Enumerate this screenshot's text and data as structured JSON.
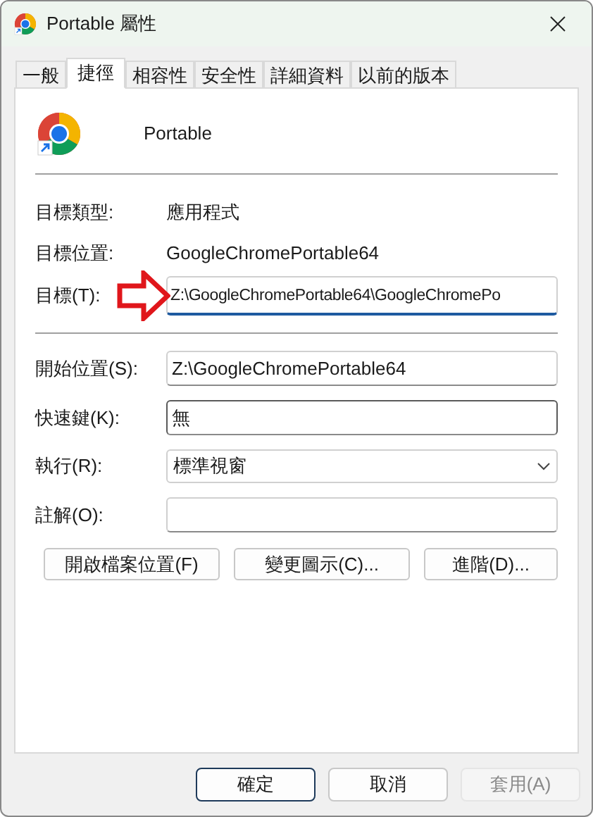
{
  "window": {
    "title": "Portable 屬性"
  },
  "tabs": [
    {
      "label": "一般",
      "selected": false
    },
    {
      "label": "捷徑",
      "selected": true
    },
    {
      "label": "相容性",
      "selected": false
    },
    {
      "label": "安全性",
      "selected": false
    },
    {
      "label": "詳細資料",
      "selected": false
    },
    {
      "label": "以前的版本",
      "selected": false
    }
  ],
  "shortcut": {
    "name": "Portable"
  },
  "info": [
    {
      "label": "目標類型:",
      "value": "應用程式"
    },
    {
      "label": "目標位置:",
      "value": "GoogleChromePortable64"
    }
  ],
  "target": {
    "label": "目標(T):",
    "value": "Z:\\GoogleChromePortable64\\GoogleChromePo",
    "focused": true,
    "annotated": true
  },
  "fields": [
    {
      "kind": "text",
      "label": "開始位置(S):",
      "value": "Z:\\GoogleChromePortable64",
      "hovered": false
    },
    {
      "kind": "text",
      "label": "快速鍵(K):",
      "value": "無",
      "hovered": true
    },
    {
      "kind": "select",
      "label": "執行(R):",
      "value": "標準視窗",
      "hovered": false
    },
    {
      "kind": "text",
      "label": "註解(O):",
      "hovered": false
    }
  ],
  "actions": [
    "開啟檔案位置(F)",
    "變更圖示(C)...",
    "進階(D)..."
  ],
  "buttons": [
    {
      "label": "確定",
      "default": true,
      "disabled": false
    },
    {
      "label": "取消",
      "default": false,
      "disabled": false
    },
    {
      "label": "套用(A)",
      "default": false,
      "disabled": true
    }
  ]
}
